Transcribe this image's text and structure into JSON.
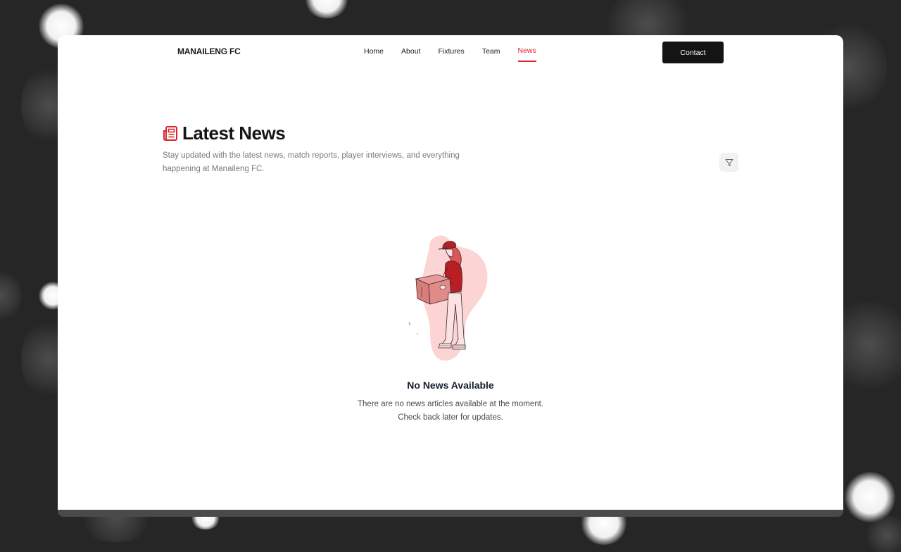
{
  "site": {
    "brand": "MANAILENG FC"
  },
  "nav": {
    "items": [
      {
        "label": "Home"
      },
      {
        "label": "About"
      },
      {
        "label": "Fixtures"
      },
      {
        "label": "Team"
      },
      {
        "label": "News",
        "active": true
      }
    ],
    "contact_label": "Contact"
  },
  "page": {
    "title": "Latest News",
    "subtitle": "Stay updated with the latest news, match reports, player interviews, and everything happening at Manaileng FC.",
    "filter_icon": "filter-icon",
    "title_icon": "newspaper-icon"
  },
  "empty_state": {
    "title": "No News Available",
    "line1": "There are no news articles available at the moment.",
    "line2": "Check back later for updates.",
    "illustration": "delivery-person-with-box"
  },
  "colors": {
    "accent": "#d8232a",
    "button_bg": "#141414",
    "backdrop": "#262626"
  }
}
